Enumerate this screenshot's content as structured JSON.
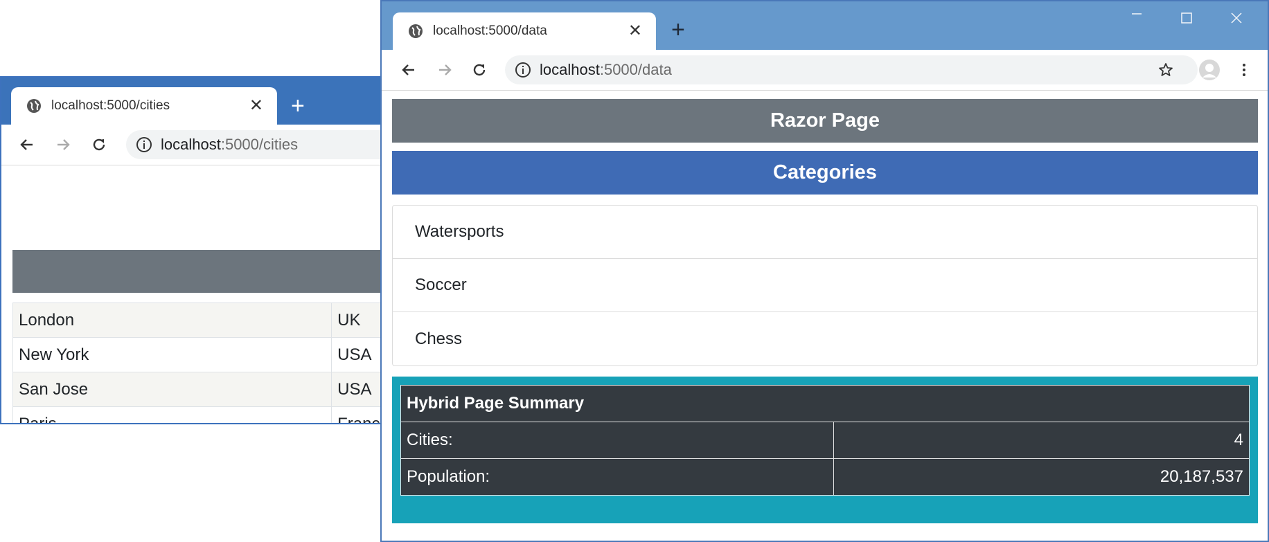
{
  "back_window": {
    "tab_title": "localhost:5000/cities",
    "url_host": "localhost",
    "url_path": ":5000/cities",
    "rows": [
      {
        "city": "London",
        "country": "UK"
      },
      {
        "city": "New York",
        "country": "USA"
      },
      {
        "city": "San Jose",
        "country": "USA"
      },
      {
        "city": "Paris",
        "country": "France"
      }
    ]
  },
  "front_window": {
    "tab_title": "localhost:5000/data",
    "url_host": "localhost",
    "url_path": ":5000/data",
    "page_title": "Razor Page",
    "categories_title": "Categories",
    "categories": [
      "Watersports",
      "Soccer",
      "Chess"
    ],
    "summary": {
      "title": "Hybrid Page Summary",
      "cities_label": "Cities:",
      "cities_value": "4",
      "population_label": "Population:",
      "population_value": "20,187,537"
    }
  },
  "icons": {
    "tab": "globe-icon",
    "close": "close-icon",
    "new_tab": "plus-icon",
    "back": "arrow-left-icon",
    "forward": "arrow-right-icon",
    "reload": "reload-icon",
    "site_info": "info-icon",
    "bookmark": "star-icon",
    "profile": "profile-icon",
    "menu": "kebab-menu-icon",
    "minimize": "minimize-icon",
    "maximize": "maximize-icon",
    "window_close": "window-close-icon"
  },
  "colors": {
    "back_titlebar": "#3b73ba",
    "front_titlebar": "#6699cc",
    "page_header": "#6c757d",
    "categories_header": "#3f6bb5",
    "summary_bg": "#17a2b8",
    "summary_table": "#343a40"
  }
}
